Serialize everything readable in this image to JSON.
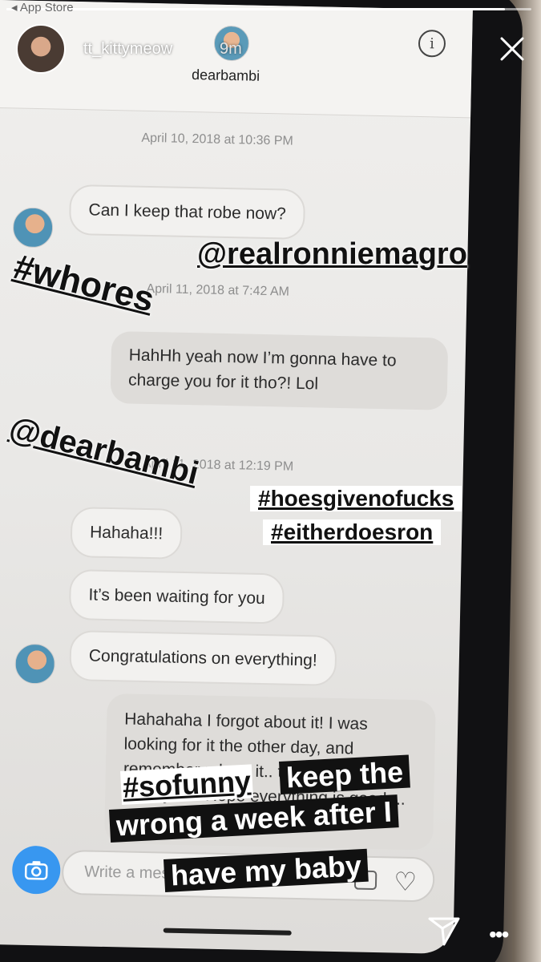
{
  "statusbar": {
    "back_label": "◂ App Store"
  },
  "story": {
    "username": "tt_kittymeow",
    "time": "9m",
    "progress": 0.95
  },
  "dm": {
    "username": "dearbambi",
    "info_glyph": "i",
    "messages": [
      {
        "type": "timestamp",
        "text": "April 10, 2018 at 10:36 PM"
      },
      {
        "type": "incoming",
        "text": "Can I keep that robe now?"
      },
      {
        "type": "timestamp",
        "text": "April 11, 2018 at 7:42 AM"
      },
      {
        "type": "outgoing",
        "text": "HahHh yeah now I’m gonna have to charge you for it tho?! Lol"
      },
      {
        "type": "timestamp",
        "text": "April 11, 2018 at 12:19 PM"
      },
      {
        "type": "incoming",
        "text": "Hahaha!!!"
      },
      {
        "type": "incoming",
        "text": "It’s been waiting for you"
      },
      {
        "type": "incoming",
        "text": "Congratulations on everything!"
      },
      {
        "type": "outgoing",
        "text": "Hahahaha I forgot about it! I was looking for it the other day, and remember u kept it.. thank you very ... busy year! Hope everything is good ... you"
      }
    ],
    "composer_placeholder": "Write a message..."
  },
  "stickers": {
    "whores": "#whores",
    "ronnie": "@realronniemagro",
    "dearbambi": "@dearbambi",
    "hoes": "#hoesgivenofucks",
    "either": "#eitherdoesron",
    "sofunny": "#sofunny",
    "caption_line1": "keep the",
    "caption_line2": "wrong a week after I",
    "caption_line3": "have my baby"
  },
  "icons": {
    "close": "close-icon",
    "info": "info-icon",
    "camera": "camera-icon",
    "heart": "heart-icon",
    "send": "send-icon",
    "more": "more-icon"
  },
  "colors": {
    "camera_blue": "#3897f0",
    "sticker_text": "#111111",
    "screen_bg": "#efeeec"
  }
}
